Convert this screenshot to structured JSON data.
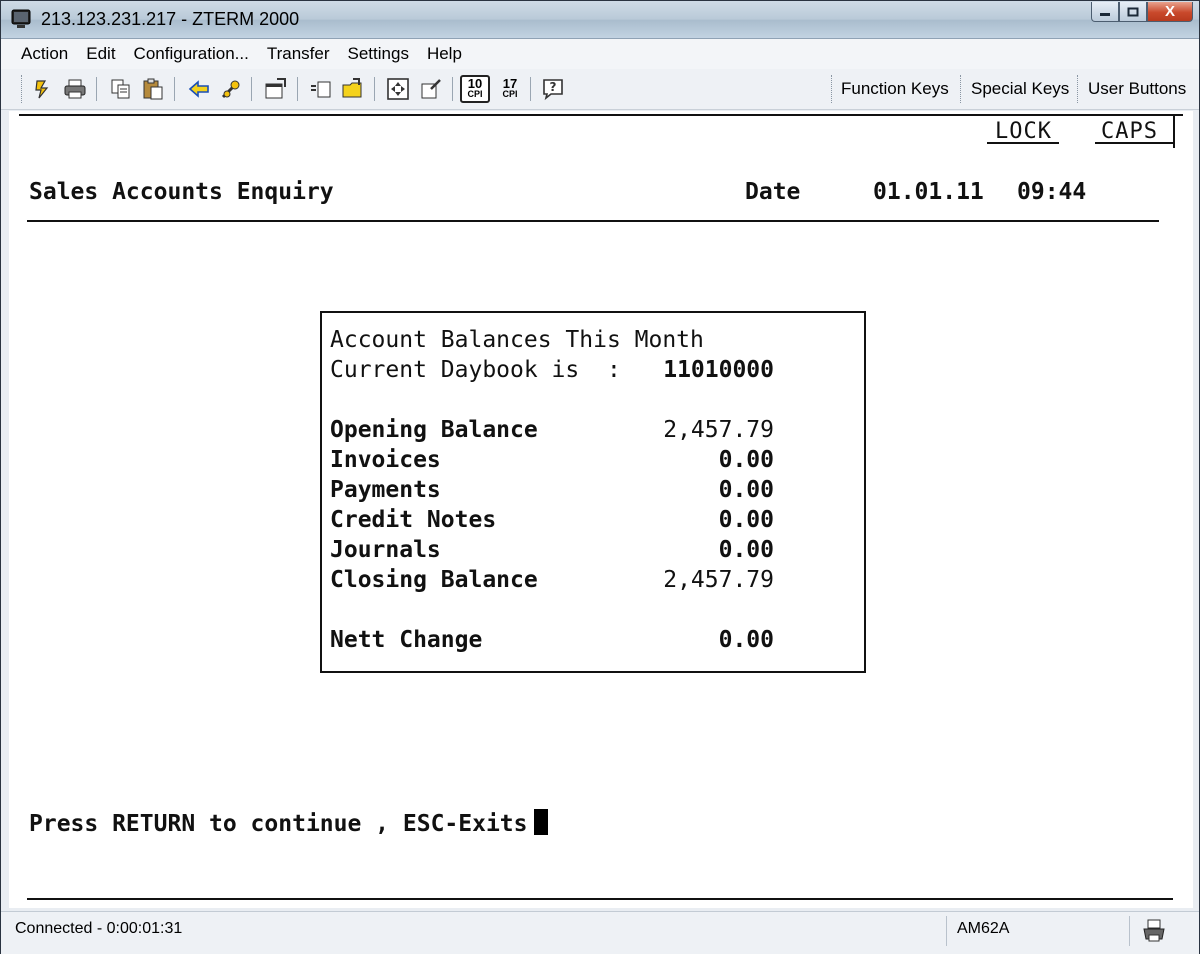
{
  "window": {
    "title": "213.123.231.217 - ZTERM 2000",
    "controls": {
      "minimize": "—",
      "maximize": "□",
      "close": "X"
    }
  },
  "menu": [
    "Action",
    "Edit",
    "Configuration...",
    "Transfer",
    "Settings",
    "Help"
  ],
  "toolbar": {
    "icons": [
      "connect-icon",
      "print-icon",
      "copy-icon",
      "paste-icon",
      "back-arrow-icon",
      "tools-icon",
      "properties-icon",
      "new-session-icon",
      "open-folder-icon",
      "fullscreen-icon",
      "edit-icon",
      "cpi-10-icon",
      "cpi-17-icon",
      "help-icon"
    ],
    "cpi10_label": "10",
    "cpi17_label": "17",
    "cpi_suffix": "CPI",
    "function_keys": "Function Keys",
    "special_keys": "Special Keys",
    "user_buttons": "User Buttons"
  },
  "terminal": {
    "lock": "LOCK",
    "caps": "CAPS",
    "screen_title": "Sales Accounts Enquiry",
    "date_label": "Date",
    "date_value": "01.01.11",
    "time_value": "09:44",
    "panel": {
      "heading": "Account Balances This Month",
      "daybook_label": "Current Daybook is  :",
      "daybook_value": "11010000",
      "rows": [
        {
          "label": "Opening Balance",
          "value": "2,457.79"
        },
        {
          "label": "Invoices",
          "value": "0.00"
        },
        {
          "label": "Payments",
          "value": "0.00"
        },
        {
          "label": "Credit Notes",
          "value": "0.00"
        },
        {
          "label": "Journals",
          "value": "0.00"
        },
        {
          "label": "Closing Balance",
          "value": "2,457.79"
        }
      ],
      "nett_label": "Nett Change",
      "nett_value": "0.00"
    },
    "prompt": "Press RETURN to continue , ESC-Exits"
  },
  "status": {
    "connection": "Connected - 0:00:01:31",
    "emulation": "AM62A"
  }
}
